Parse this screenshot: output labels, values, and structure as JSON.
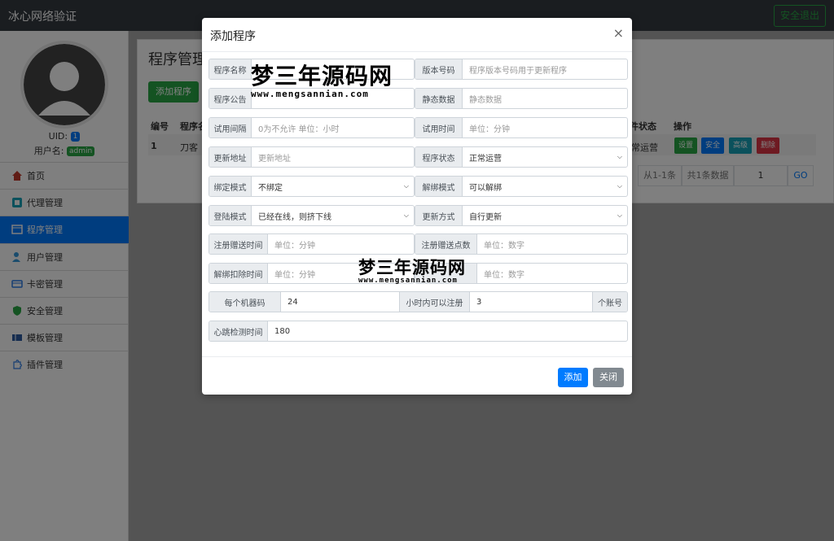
{
  "app": {
    "brand": "冰心网络验证",
    "logout_label": "安全退出"
  },
  "sidebar": {
    "uid_label": "UID:",
    "uid_value": "1",
    "username_label": "用户名:",
    "username_value": "admin",
    "items": [
      {
        "label": "首页",
        "icon": "home-icon"
      },
      {
        "label": "代理管理",
        "icon": "agent-icon"
      },
      {
        "label": "程序管理",
        "icon": "program-icon"
      },
      {
        "label": "用户管理",
        "icon": "user-icon"
      },
      {
        "label": "卡密管理",
        "icon": "card-icon"
      },
      {
        "label": "安全管理",
        "icon": "shield-icon"
      },
      {
        "label": "模板管理",
        "icon": "template-icon"
      },
      {
        "label": "插件管理",
        "icon": "plugin-icon"
      }
    ],
    "active_index": 2
  },
  "main": {
    "title": "程序管理",
    "add_label": "添加程序",
    "columns": [
      "编号",
      "程序名",
      "件状态",
      "操作"
    ],
    "row": {
      "id": "1",
      "name": "刀客",
      "status": "常运营"
    },
    "actions": [
      "设置",
      "安全",
      "高级",
      "删除"
    ],
    "pager": {
      "range": "从1-1条",
      "total": "共1条数据",
      "page": "1",
      "go": "GO"
    }
  },
  "modal": {
    "title": "添加程序",
    "close_symbol": "×",
    "fields": {
      "program_name": {
        "label": "程序名称",
        "placeholder": ""
      },
      "version": {
        "label": "版本号码",
        "placeholder": "程序版本号码用于更新程序"
      },
      "notice": {
        "label": "程序公告",
        "placeholder": ""
      },
      "static_data": {
        "label": "静态数据",
        "placeholder": "静态数据"
      },
      "trial_interval": {
        "label": "试用间隔",
        "placeholder": "0为不允许 单位：小时"
      },
      "trial_time": {
        "label": "试用时间",
        "placeholder": "单位：分钟"
      },
      "update_url": {
        "label": "更新地址",
        "placeholder": "更新地址"
      },
      "program_status": {
        "label": "程序状态",
        "value": "正常运营"
      },
      "bind_mode": {
        "label": "绑定模式",
        "value": "不绑定"
      },
      "unbind_mode": {
        "label": "解绑模式",
        "value": "可以解绑"
      },
      "login_mode": {
        "label": "登陆模式",
        "value": "已经在线，则挤下线"
      },
      "update_mode": {
        "label": "更新方式",
        "value": "自行更新"
      },
      "reg_gift_time": {
        "label": "注册赠送时间",
        "placeholder": "单位：分钟"
      },
      "reg_gift_points": {
        "label": "注册赠送点数",
        "placeholder": "单位：数字"
      },
      "unbind_deduct_time": {
        "label": "解绑扣除时间",
        "placeholder": "单位：分钟"
      },
      "unbind_deduct_points": {
        "label": "",
        "placeholder": "单位：数字"
      },
      "per_machine": {
        "label": "每个机器码",
        "value": "24"
      },
      "hours_register": {
        "label": "小时内可以注册",
        "value": "3",
        "suffix": "个账号"
      },
      "heartbeat": {
        "label": "心跳检测时间",
        "value": "180"
      }
    },
    "add_label": "添加",
    "close_label": "关闭"
  },
  "watermark": {
    "text": "梦三年源码网",
    "url": "www.mengsannian.com"
  }
}
